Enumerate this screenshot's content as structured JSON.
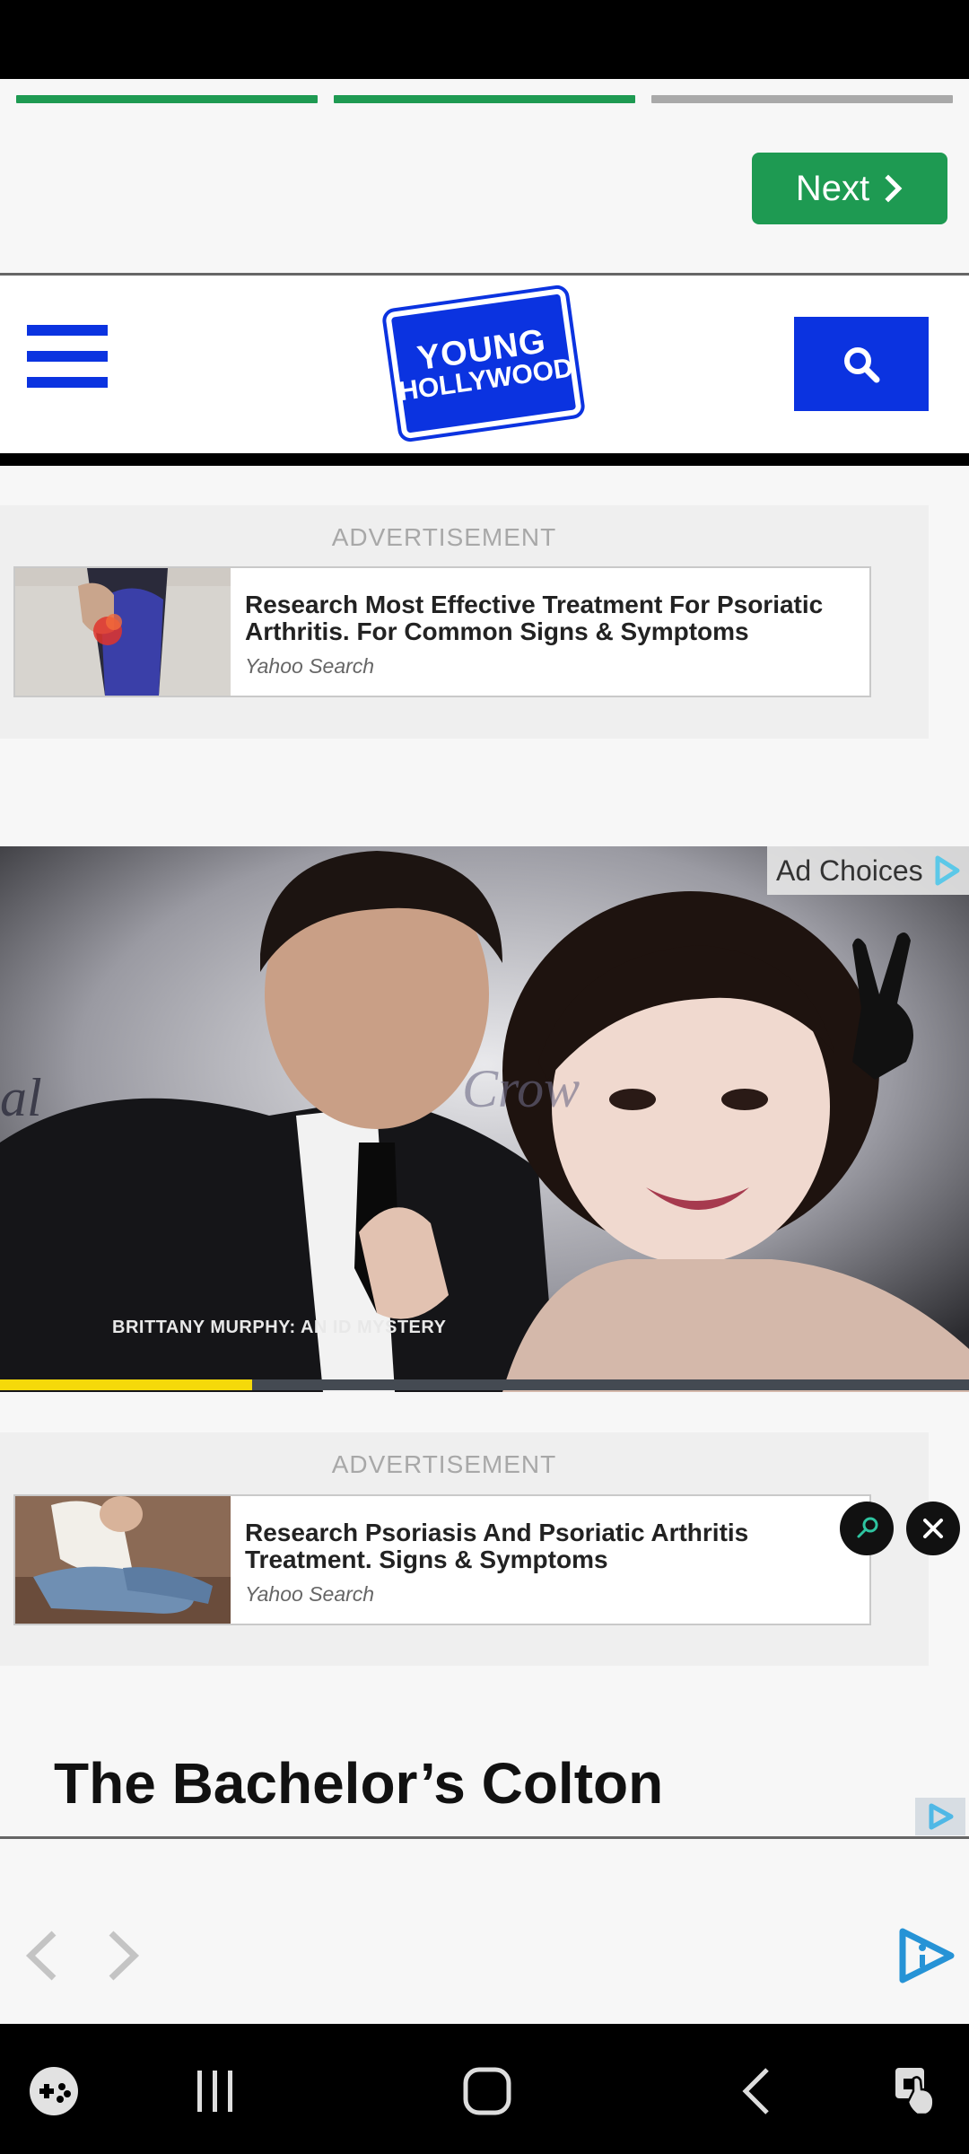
{
  "progress": {
    "segments_total": 3,
    "segments_completed": 2
  },
  "next_button": {
    "label": "Next"
  },
  "header": {
    "logo_line1": "YOUNG",
    "logo_line2": "HOLLYWOOD"
  },
  "ads": [
    {
      "label": "ADVERTISEMENT",
      "title": "Research Most Effective Treatment For Psoriatic Arthritis. For Common Signs & Symptoms",
      "source": "Yahoo Search"
    },
    {
      "label": "ADVERTISEMENT",
      "title": "Research Psoriasis And Psoriatic Arthritis Treatment. Signs & Symptoms",
      "source": "Yahoo Search"
    }
  ],
  "video": {
    "ad_choices_label": "Ad Choices",
    "caption": "BRITTANY MURPHY: AN ID MYSTERY",
    "progress_fraction": 0.26
  },
  "quote_marks": "\" \"",
  "article": {
    "headline": "The Bachelor’s Colton"
  },
  "colors": {
    "accent_blue": "#0b33e0",
    "next_green": "#1e9a52",
    "video_progress": "#f5d90a"
  }
}
